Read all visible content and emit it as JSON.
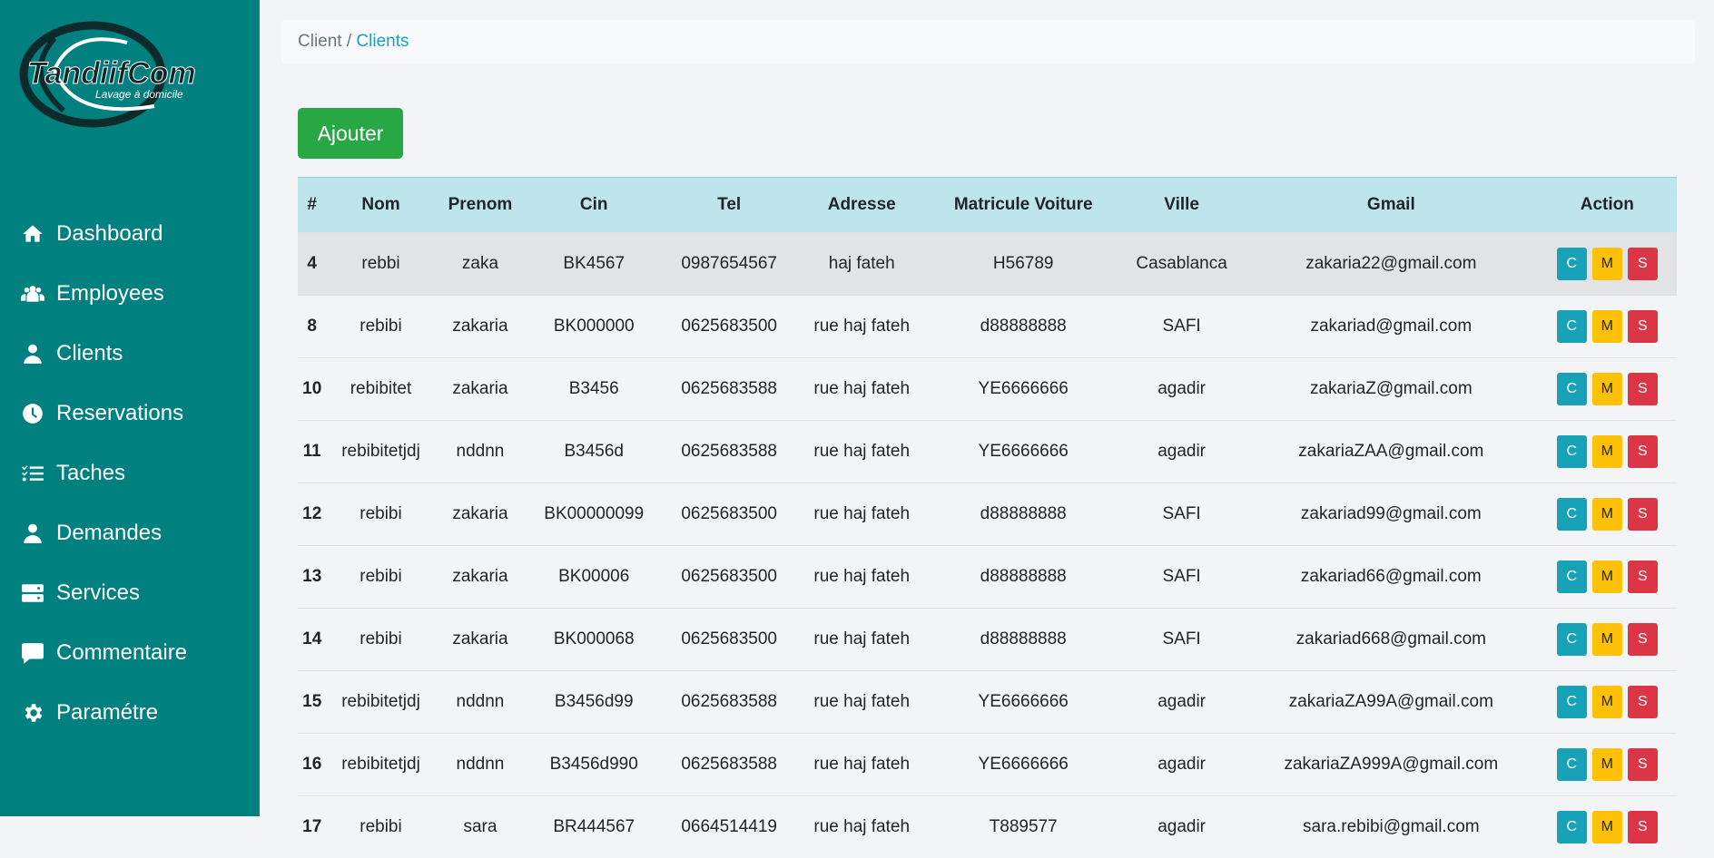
{
  "brand": {
    "logo_text": "TandiifCom",
    "logo_tagline": "Lavage à domicile"
  },
  "sidebar": {
    "items": [
      {
        "label": "Dashboard",
        "icon": "home-icon"
      },
      {
        "label": "Employees",
        "icon": "users-icon"
      },
      {
        "label": "Clients",
        "icon": "user-icon"
      },
      {
        "label": "Reservations",
        "icon": "clock-icon"
      },
      {
        "label": "Taches",
        "icon": "tasks-icon"
      },
      {
        "label": "Demandes",
        "icon": "user-icon"
      },
      {
        "label": "Services",
        "icon": "server-icon"
      },
      {
        "label": "Commentaire",
        "icon": "comment-icon"
      },
      {
        "label": "Paramétre",
        "icon": "gear-icon"
      }
    ]
  },
  "breadcrumb": {
    "parent": "Client",
    "separator": " / ",
    "current": "Clients"
  },
  "toolbar": {
    "add_label": "Ajouter"
  },
  "table": {
    "headers": [
      "#",
      "Nom",
      "Prenom",
      "Cin",
      "Tel",
      "Adresse",
      "Matricule Voiture",
      "Ville",
      "Gmail",
      "Action"
    ],
    "action_labels": {
      "c": "C",
      "m": "M",
      "s": "S"
    },
    "rows": [
      [
        "4",
        "rebbi",
        "zaka",
        "BK4567",
        "0987654567",
        "haj fateh",
        "H56789",
        "Casablanca",
        "zakaria22@gmail.com"
      ],
      [
        "8",
        "rebibi",
        "zakaria",
        "BK000000",
        "0625683500",
        "rue haj fateh",
        "d88888888",
        "SAFI",
        "zakariad@gmail.com"
      ],
      [
        "10",
        "rebibitet",
        "zakaria",
        "B3456",
        "0625683588",
        "rue haj fateh",
        "YE6666666",
        "agadir",
        "zakariaZ@gmail.com"
      ],
      [
        "11",
        "rebibitetjdj",
        "nddnn",
        "B3456d",
        "0625683588",
        "rue haj fateh",
        "YE6666666",
        "agadir",
        "zakariaZAA@gmail.com"
      ],
      [
        "12",
        "rebibi",
        "zakaria",
        "BK00000099",
        "0625683500",
        "rue haj fateh",
        "d88888888",
        "SAFI",
        "zakariad99@gmail.com"
      ],
      [
        "13",
        "rebibi",
        "zakaria",
        "BK00006",
        "0625683500",
        "rue haj fateh",
        "d88888888",
        "SAFI",
        "zakariad66@gmail.com"
      ],
      [
        "14",
        "rebibi",
        "zakaria",
        "BK000068",
        "0625683500",
        "rue haj fateh",
        "d88888888",
        "SAFI",
        "zakariad668@gmail.com"
      ],
      [
        "15",
        "rebibitetjdj",
        "nddnn",
        "B3456d99",
        "0625683588",
        "rue haj fateh",
        "YE6666666",
        "agadir",
        "zakariaZA99A@gmail.com"
      ],
      [
        "16",
        "rebibitetjdj",
        "nddnn",
        "B3456d990",
        "0625683588",
        "rue haj fateh",
        "YE6666666",
        "agadir",
        "zakariaZA999A@gmail.com"
      ],
      [
        "17",
        "rebibi",
        "sara",
        "BR444567",
        "0664514419",
        "rue haj fateh",
        "T889577",
        "agadir",
        "sara.rebibi@gmail.com"
      ]
    ]
  },
  "colors": {
    "sidebar": "#018080",
    "add": "#28a745",
    "header_row": "#bee5eb",
    "c": "#17a2b8",
    "m": "#ffc107",
    "s": "#dc3545"
  }
}
